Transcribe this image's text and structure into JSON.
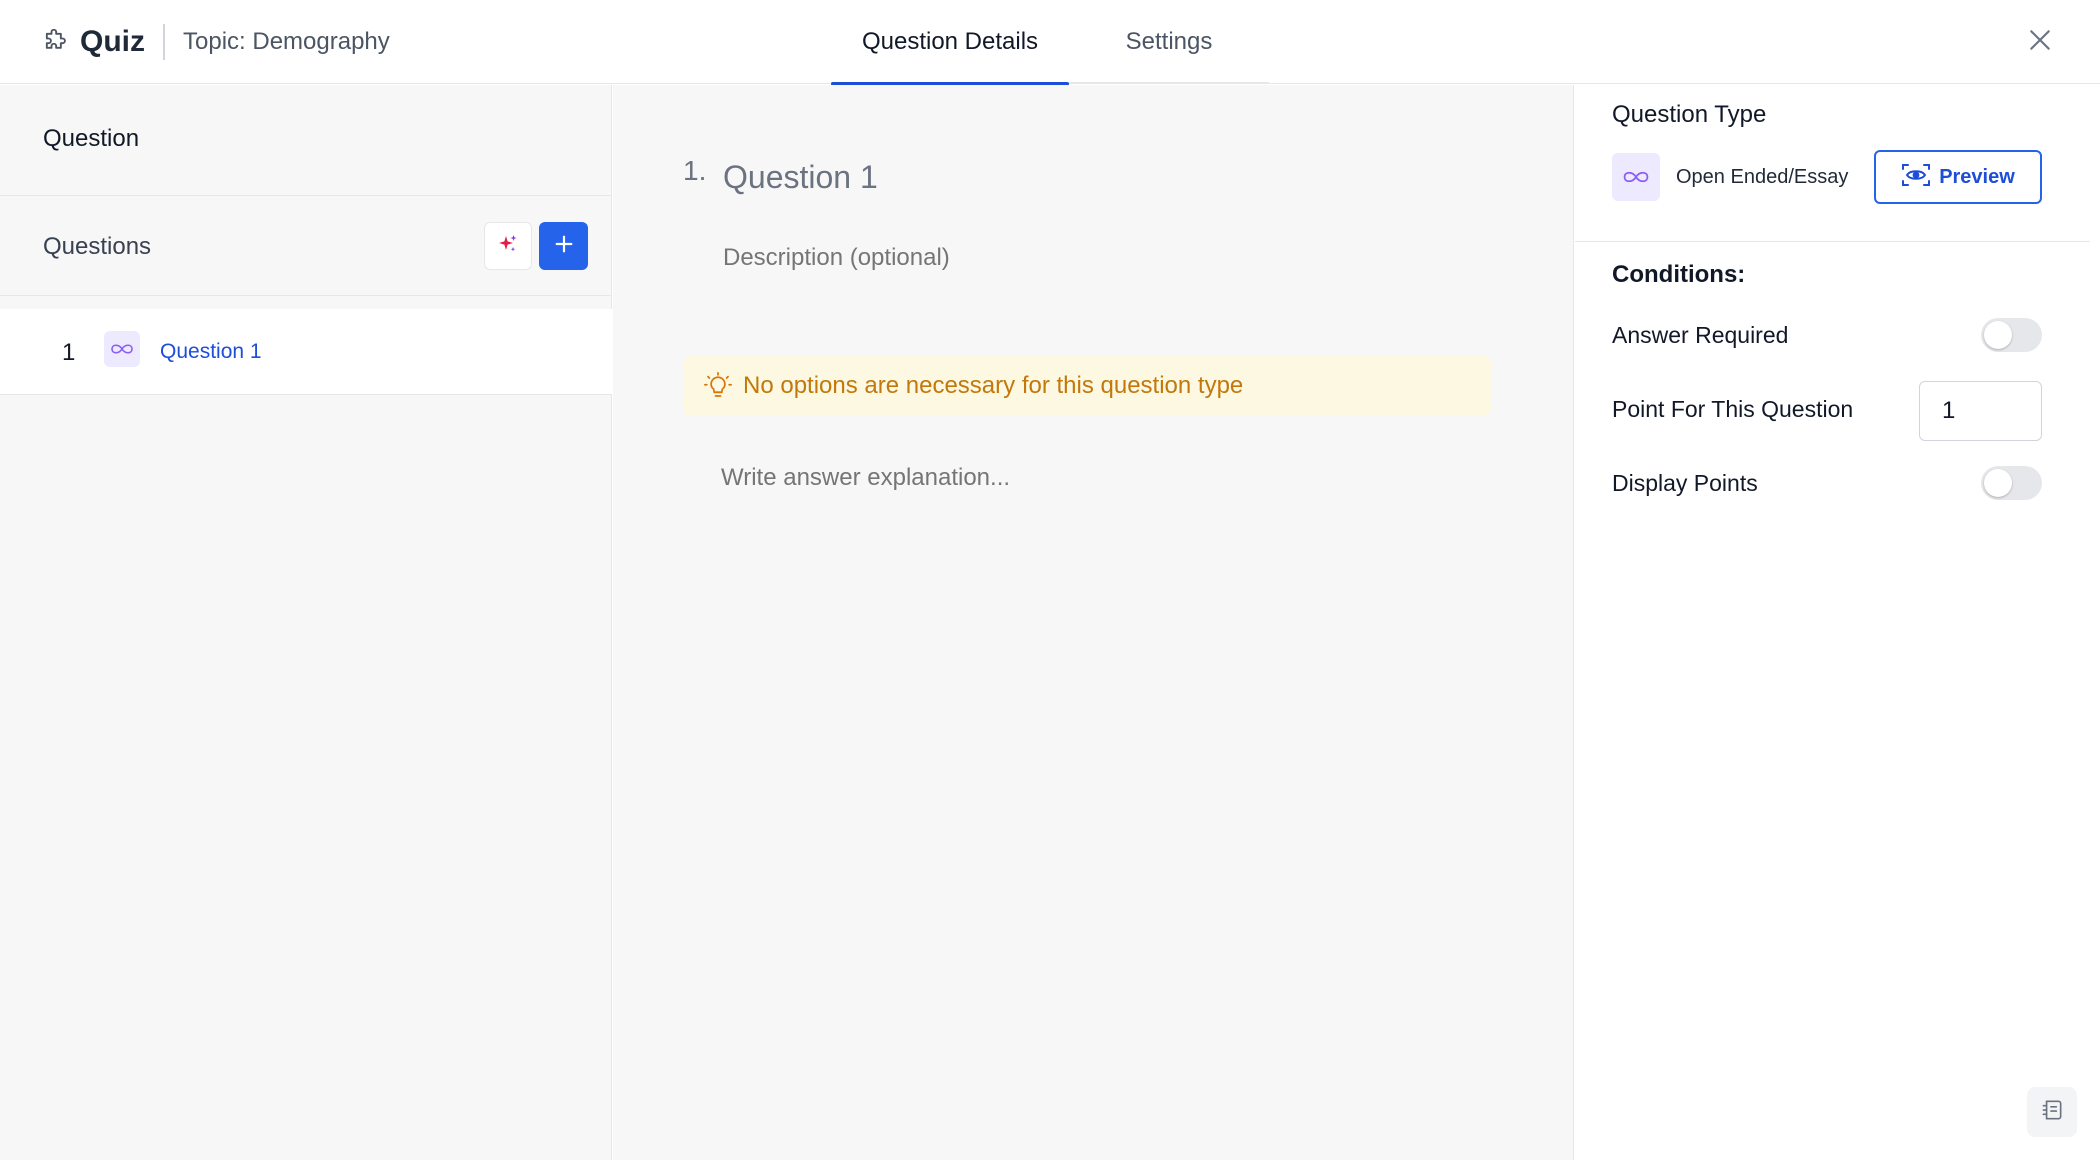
{
  "header": {
    "brand_icon": "puzzle-icon",
    "title": "Quiz",
    "topic": "Topic: Demography",
    "close_icon": "close-icon"
  },
  "tabs": [
    {
      "label": "Question Details",
      "active": true
    },
    {
      "label": "Settings",
      "active": false
    }
  ],
  "sidebar": {
    "title": "Question",
    "questions_heading": "Questions",
    "ai_icon": "sparkle-icon",
    "add_icon": "plus-icon",
    "items": [
      {
        "number": "1",
        "icon": "infinity-icon",
        "label": "Question 1"
      }
    ]
  },
  "editor": {
    "number": "1.",
    "question_title": "Question 1",
    "description_placeholder": "Description (optional)",
    "notice_icon": "lightbulb-icon",
    "notice": "No options are necessary for this question type",
    "explanation_placeholder": "Write answer explanation..."
  },
  "settings": {
    "question_type_label": "Question Type",
    "question_type_icon": "infinity-icon",
    "question_type": "Open Ended/Essay",
    "preview_icon": "eye-scan-icon",
    "preview_label": "Preview",
    "conditions_label": "Conditions:",
    "answer_required_label": "Answer Required",
    "answer_required": false,
    "points_label": "Point For This Question",
    "points_value": "1",
    "display_points_label": "Display Points",
    "display_points": false
  },
  "help_icon": "notes-icon",
  "colors": {
    "accent": "#2563eb",
    "notice_bg": "#fdf8e1",
    "notice_text": "#c2780a",
    "icon_bg": "#ede9fe"
  }
}
